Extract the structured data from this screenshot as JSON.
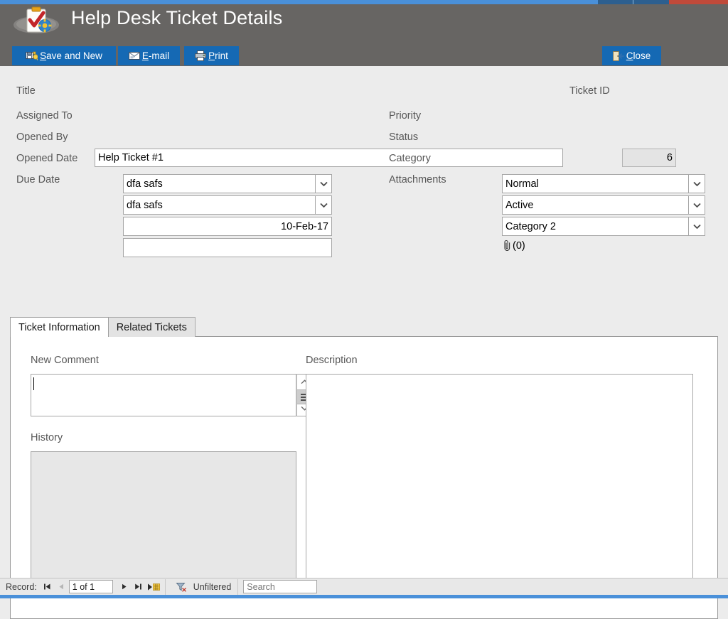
{
  "window": {
    "title": "Help Desk Ticket Details",
    "logo_icon": "clipboard-checkmark-gear-icon",
    "header_bg": "#676563",
    "accent": "#1569b4",
    "titlebar_accent": "#4a90d9",
    "close_button_color": "#c04a3a"
  },
  "toolbar": {
    "save_and_new": {
      "label_pre": "",
      "accel": "S",
      "label_post": "ave and New",
      "full": "Save and New",
      "icon": "save-new-record-icon"
    },
    "email": {
      "accel": "E",
      "label_post": "-mail",
      "full": "E-mail",
      "icon": "envelope-icon"
    },
    "print": {
      "accel": "P",
      "label_post": "rint",
      "full": "Print",
      "icon": "printer-icon"
    },
    "close": {
      "accel": "C",
      "label_post": "lose",
      "full": "Close",
      "icon": "exit-door-icon"
    }
  },
  "form": {
    "title": {
      "label": "Title",
      "value": "Help Ticket #1"
    },
    "ticket_id": {
      "label": "Ticket ID",
      "value": "6",
      "readonly": true
    },
    "assigned_to": {
      "label": "Assigned To",
      "value": "dfa safs",
      "type": "combobox"
    },
    "opened_by": {
      "label": "Opened By",
      "value": "dfa safs",
      "type": "combobox"
    },
    "opened_date": {
      "label": "Opened Date",
      "value": "10-Feb-17"
    },
    "due_date": {
      "label": "Due Date",
      "value": ""
    },
    "priority": {
      "label": "Priority",
      "value": "Normal",
      "type": "combobox"
    },
    "status": {
      "label": "Status",
      "value": "Active",
      "type": "combobox"
    },
    "category": {
      "label": "Category",
      "value": "Category 2",
      "type": "combobox"
    },
    "attachments": {
      "label": "Attachments",
      "value": "(0)",
      "icon": "paperclip-icon"
    }
  },
  "tabs": [
    {
      "label": "Ticket Information",
      "active": true
    },
    {
      "label": "Related Tickets",
      "active": false
    }
  ],
  "ticket_information": {
    "new_comment": {
      "label": "New Comment",
      "value": ""
    },
    "history": {
      "label": "History",
      "value": "",
      "readonly": true
    },
    "description": {
      "label": "Description",
      "value": ""
    }
  },
  "record_nav": {
    "label": "Record:",
    "first_icon": "first-record-icon",
    "previous_icon": "previous-record-icon",
    "position": "1 of 1",
    "next_icon": "next-record-icon",
    "last_icon": "last-record-icon",
    "new_icon": "new-record-icon",
    "filter_icon": "filter-icon",
    "filter_status": "Unfiltered",
    "search_placeholder": "Search",
    "search_value": ""
  }
}
